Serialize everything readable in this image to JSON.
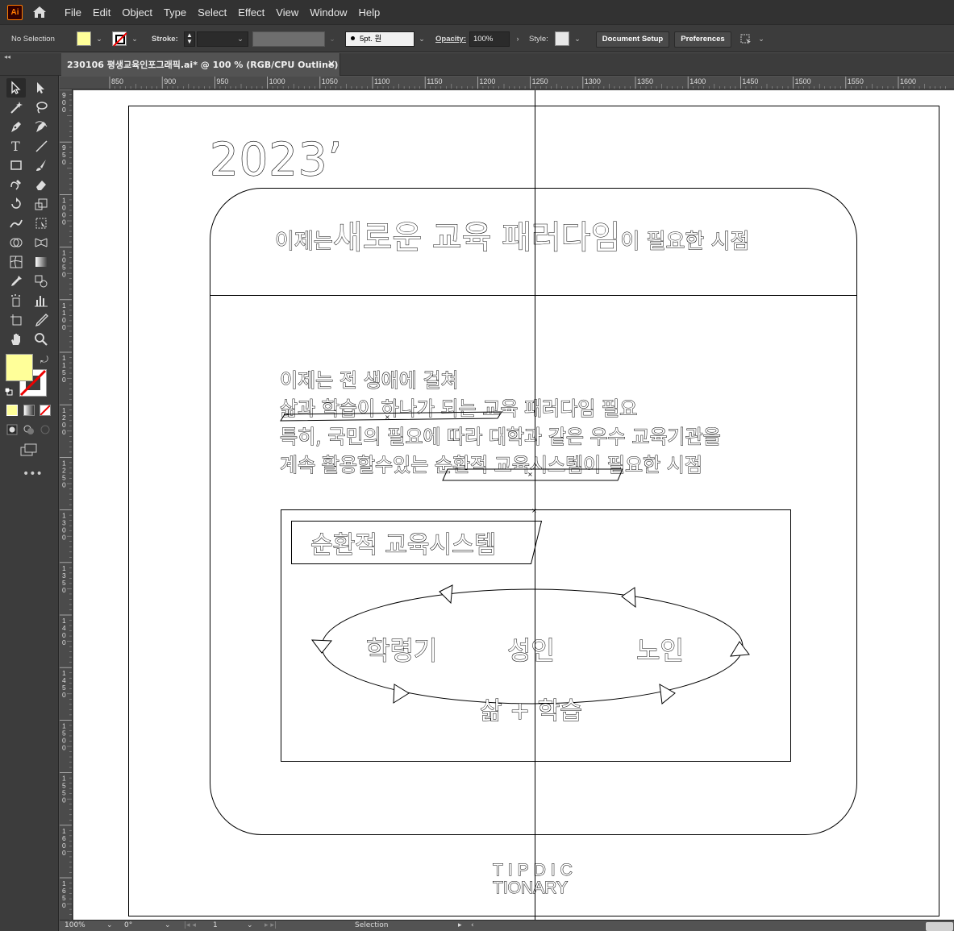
{
  "app": {
    "logo": "Ai",
    "home_icon": "home-icon"
  },
  "menu": [
    "File",
    "Edit",
    "Object",
    "Type",
    "Select",
    "Effect",
    "View",
    "Window",
    "Help"
  ],
  "control_bar": {
    "selection": "No Selection",
    "fill_color": "#ffff99",
    "stroke_label": "Stroke:",
    "brush_value": "5pt. 원",
    "opacity_label": "Opacity:",
    "opacity_value": "100%",
    "style_label": "Style:",
    "document_setup": "Document Setup",
    "preferences": "Preferences"
  },
  "document_tab": {
    "title": "230106 평생교육인포그래픽.ai* @ 100 % (RGB/CPU Outline)",
    "close": "×"
  },
  "tools": [
    "selection-tool",
    "direct-selection-tool",
    "magic-wand-tool",
    "lasso-tool",
    "pen-tool",
    "curvature-tool",
    "type-tool",
    "line-tool",
    "rectangle-tool",
    "paintbrush-tool",
    "shaper-tool",
    "eraser-tool",
    "rotate-tool",
    "scale-tool",
    "warp-tool",
    "free-transform-tool",
    "shape-builder-tool",
    "perspective-grid-tool",
    "mesh-tool",
    "gradient-tool",
    "eyedropper-tool",
    "blend-tool",
    "symbol-sprayer-tool",
    "column-graph-tool",
    "artboard-tool",
    "slice-tool",
    "hand-tool",
    "zoom-tool"
  ],
  "ruler": {
    "top_ticks": [
      "850",
      "900",
      "950",
      "1000",
      "1050",
      "1100",
      "1150",
      "1200",
      "1250",
      "1300",
      "1350",
      "1400",
      "1450",
      "1500",
      "1550",
      "1600"
    ],
    "left_ticks": [
      "900",
      "950",
      "1000",
      "1050",
      "1100",
      "1150",
      "1200",
      "1250",
      "1300",
      "1350",
      "1400",
      "1450",
      "1500",
      "1550",
      "1600",
      "1650"
    ]
  },
  "artwork": {
    "year": "2023’",
    "headline_small_left": "이제는",
    "headline_large": "새로운 교육 패러다임",
    "headline_small_right": "이 필요한 시점",
    "body_lines": [
      "이제는 전 생애에 걸쳐",
      "삶과 학습이 하나가 되는 교육 패러다임 필요",
      "특히, 국민의 필요에 따라 대학과 같은 우수 교육기관을",
      "계속 활용할수있는 순환적 교육시스템이 필요한 시점"
    ],
    "system_title": "순환적 교육시스템",
    "cycle_labels": [
      "학령기",
      "성인",
      "노인"
    ],
    "cycle_bottom": "삶 + 학습",
    "brand_line1": "TIPDIC",
    "brand_line2": "TIONARY"
  },
  "status_bar": {
    "zoom": "100%",
    "rotation": "0°",
    "artboard": "1",
    "mode": "Selection"
  }
}
